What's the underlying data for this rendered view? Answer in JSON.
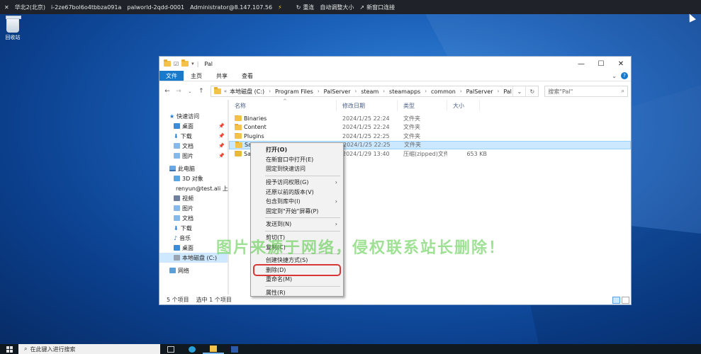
{
  "remote_bar": {
    "region": "华北2(北京)",
    "instance_id": "i-2ze67bol6o4tbbza091a",
    "instance_name": "palworld-2qdd-0001",
    "account": "Administrator@8.147.107.56",
    "actions": [
      "重连",
      "自动调整大小",
      "新窗口连接"
    ]
  },
  "desktop": {
    "recycle_bin_label": "回收站",
    "watermark": "图片来源于网络，侵权联系站长删除！"
  },
  "explorer": {
    "title": "Pal",
    "ribbon_tabs": [
      "文件",
      "主页",
      "共享",
      "查看"
    ],
    "breadcrumb": [
      "本地磁盘 (C:)",
      "Program Files",
      "PalServer",
      "steam",
      "steamapps",
      "common",
      "PalServer",
      "Pal"
    ],
    "search_placeholder": "搜索\"Pal\"",
    "nav_quick_access": "快速访问",
    "nav_quick_items": [
      "桌面",
      "下载",
      "文档",
      "图片"
    ],
    "nav_this_pc": "此电脑",
    "nav_pc_items": [
      "3D 对象",
      "renyun@test.ali 上",
      "视频",
      "图片",
      "文档",
      "下载",
      "音乐",
      "桌面",
      "本地磁盘 (C:)"
    ],
    "nav_network": "网络",
    "columns": [
      "名称",
      "修改日期",
      "类型",
      "大小"
    ],
    "files": [
      {
        "name": "Binaries",
        "date": "2024/1/25 22:24",
        "type": "文件夹",
        "size": ""
      },
      {
        "name": "Content",
        "date": "2024/1/25 22:24",
        "type": "文件夹",
        "size": ""
      },
      {
        "name": "Plugins",
        "date": "2024/1/25 22:25",
        "type": "文件夹",
        "size": ""
      },
      {
        "name": "Saved",
        "date": "2024/1/25 22:25",
        "type": "文件夹",
        "size": ""
      },
      {
        "name": "Saved",
        "date": "2024/1/29 13:40",
        "type": "压缩(zipped)文件...",
        "size": "653 KB"
      }
    ],
    "status_count": "5 个项目",
    "status_selected": "选中 1 个项目"
  },
  "context_menu": {
    "groups": [
      [
        "打开(O)",
        "在新窗口中打开(E)",
        "固定到快速访问"
      ],
      [
        "授予访问权限(G)",
        "还原以前的版本(V)",
        "包含到库中(I)",
        "固定到\"开始\"屏幕(P)"
      ],
      [
        "发送到(N)"
      ],
      [
        "剪切(T)",
        "复制(C)"
      ],
      [
        "创建快捷方式(S)",
        "删除(D)",
        "重命名(M)"
      ],
      [
        "属性(R)"
      ]
    ]
  },
  "taskbar": {
    "search_placeholder": "在此键入进行搜索"
  }
}
